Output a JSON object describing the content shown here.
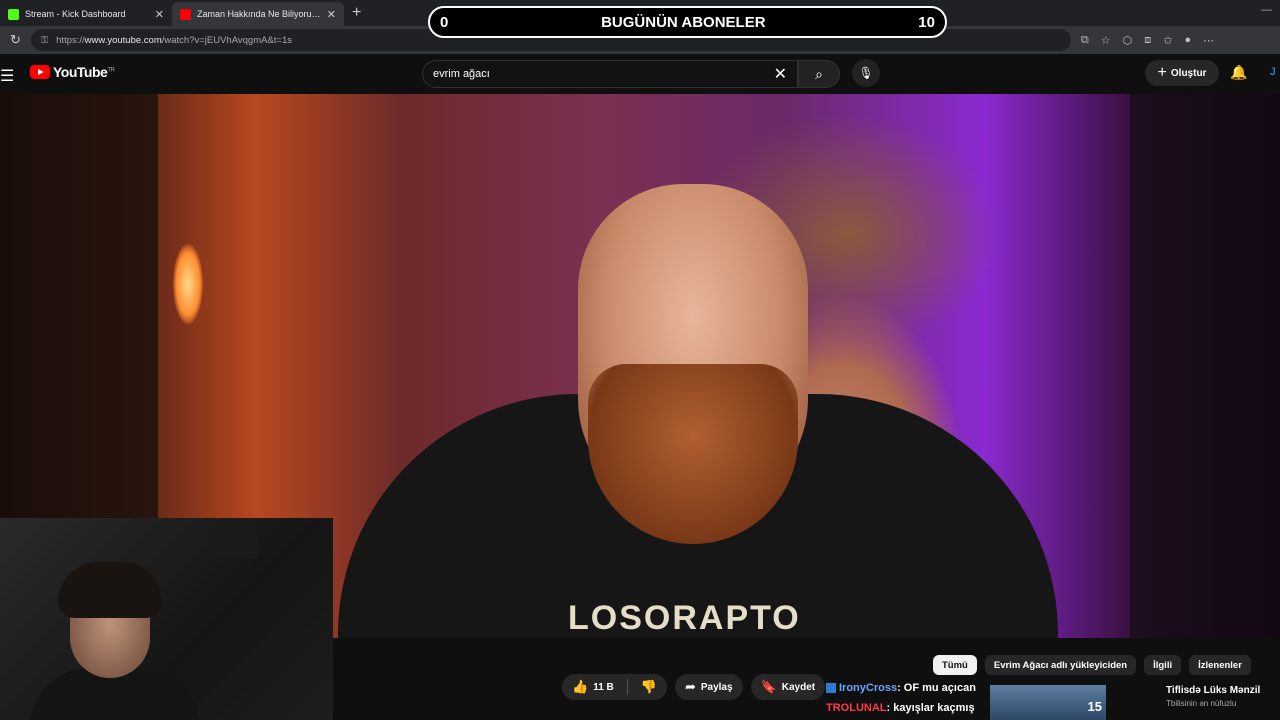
{
  "browser": {
    "tabs": [
      {
        "title": "Stream - Kick Dashboard",
        "favicon_color": "#53fc18"
      },
      {
        "title": "Zaman Hakkında Ne Biliyoruz? - Yo",
        "favicon_color": "#ff0000"
      }
    ],
    "url_prefix": "https://",
    "url_host": "www.youtube.com",
    "url_path": "/watch?v=jEUVhAvqgmA&t=1s"
  },
  "overlay": {
    "left_count": "0",
    "title": "BUGÜNÜN ABONELER",
    "right_count": "10"
  },
  "youtube": {
    "logo_text": "YouTube",
    "region": "TR",
    "search_value": "evrim ağacı",
    "create_label": "Oluştur",
    "account_initial": "J"
  },
  "video": {
    "shirt_text": "LOSORAPTO"
  },
  "chips": [
    "Tümü",
    "Evrim Ağacı adlı yükleyiciden",
    "İlgili",
    "İzlenenler"
  ],
  "actions": {
    "like_count": "11 B",
    "share_label": "Paylaş",
    "save_label": "Kaydet"
  },
  "chat": [
    {
      "user": "IronyCross",
      "message": ": OF mu açıcan",
      "color": "#6aa6ff"
    },
    {
      "user": "TROLUNAL",
      "message": ": kayışlar kaçmış",
      "color": "#ff3b4a"
    }
  ],
  "recommendation": {
    "title": "Tiflisdə Lüks Mənzil",
    "description": "Tbilisinin ən nüfuzlu",
    "thumb_badge": "15"
  }
}
